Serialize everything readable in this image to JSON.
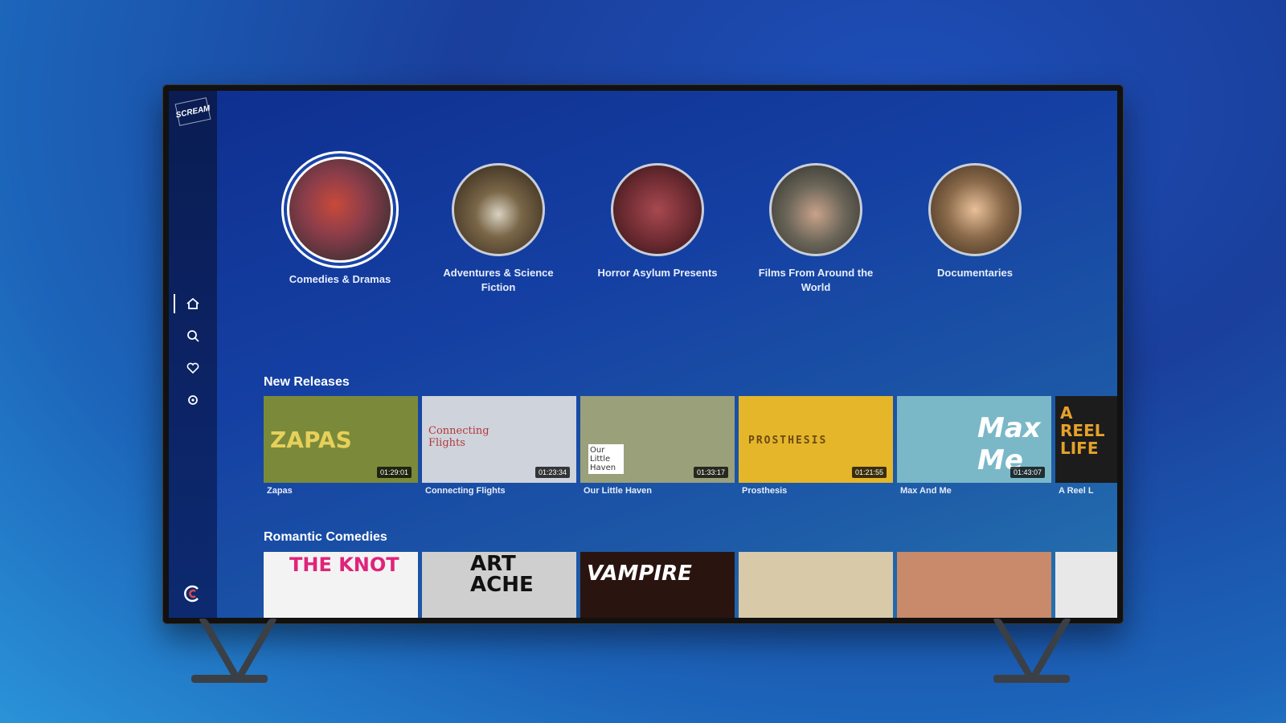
{
  "app": {
    "logo_text": "SCREAM"
  },
  "sidebar": {
    "items": [
      {
        "icon": "home-icon"
      },
      {
        "icon": "search-icon"
      },
      {
        "icon": "heart-icon"
      },
      {
        "icon": "settings-icon"
      }
    ],
    "bottom_icon": "brand-icon"
  },
  "categories": [
    {
      "label": "Comedies & Dramas",
      "color": "#8a3d4a"
    },
    {
      "label": "Adventures & Science Fiction",
      "color": "#5b4a36"
    },
    {
      "label": "Horror Asylum Presents",
      "color": "#7a2c34"
    },
    {
      "label": "Films From Around the World",
      "color": "#6a6558"
    },
    {
      "label": "Documentaries",
      "color": "#8a6a4a"
    }
  ],
  "rows": [
    {
      "title": "New Releases",
      "items": [
        {
          "title": "Zapas",
          "duration": "01:29:01",
          "art_text": "ZAPAS",
          "bg": "#7a8a3a"
        },
        {
          "title": "Connecting Flights",
          "duration": "01:23:34",
          "art_text": "Connecting Flights",
          "bg": "#cfd3dc"
        },
        {
          "title": "Our Little Haven",
          "duration": "01:33:17",
          "art_text": "Our Little Haven",
          "bg": "#9aa07a"
        },
        {
          "title": "Prosthesis",
          "duration": "01:21:55",
          "art_text": "PROSTHESIS",
          "bg": "#e5b62a"
        },
        {
          "title": "Max And Me",
          "duration": "01:43:07",
          "art_text": "Max Me",
          "bg": "#7ab8c8"
        },
        {
          "title": "A Reel L",
          "duration": "",
          "art_text": "A REEL LIFE",
          "bg": "#1c1c1c"
        }
      ]
    },
    {
      "title": "Romantic Comedies",
      "items": [
        {
          "art_text": "THE KNOT",
          "bg": "#f3f3f3"
        },
        {
          "art_text": "ART ACHE",
          "bg": "#cfcfcf"
        },
        {
          "art_text": "VAMPIRE",
          "bg": "#2a1410"
        },
        {
          "art_text": "",
          "bg": "#d8c9a8"
        },
        {
          "art_text": "",
          "bg": "#c88a6a"
        },
        {
          "art_text": "",
          "bg": "#e8e8e8"
        }
      ]
    }
  ]
}
